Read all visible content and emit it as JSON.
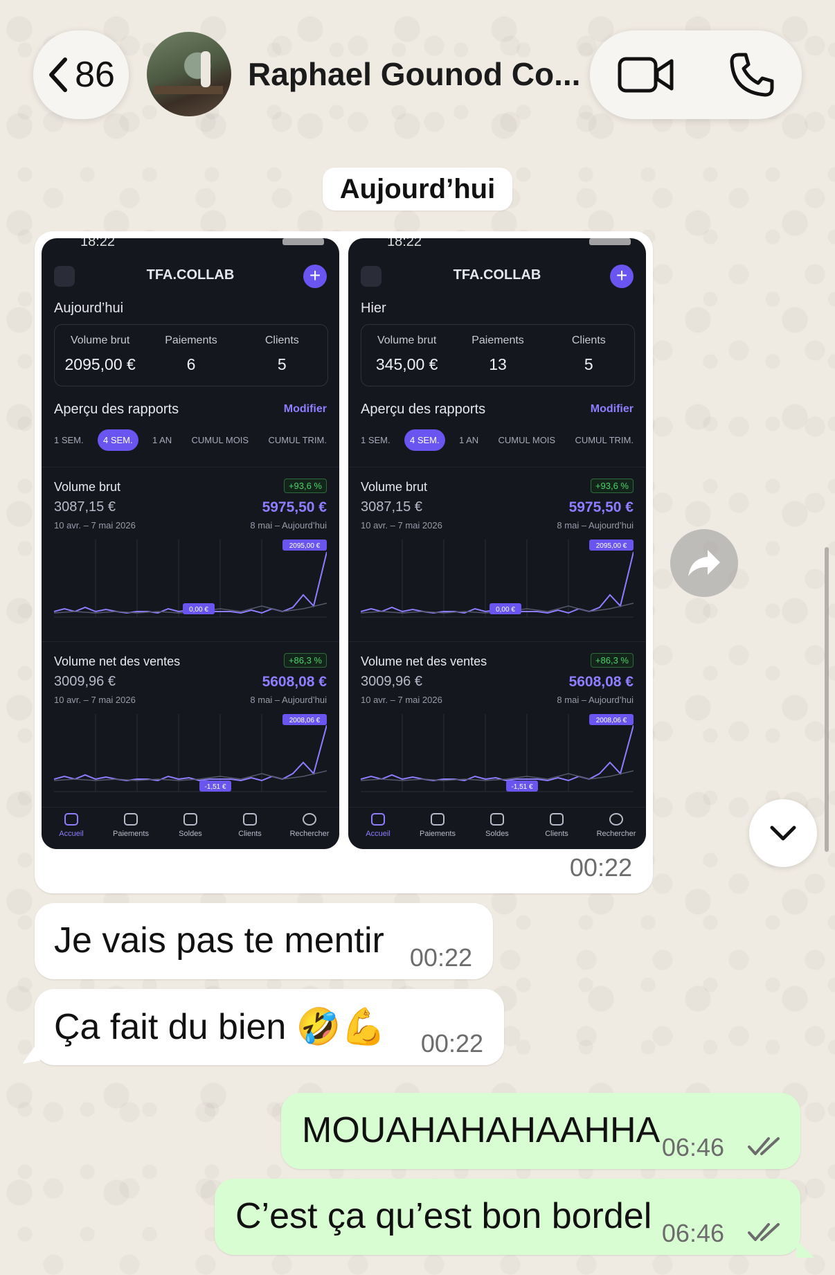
{
  "header": {
    "back_count": "86",
    "contact_name": "Raphael Gounod Co..."
  },
  "date_chip": "Aujourd’hui",
  "image_message": {
    "time": "00:22",
    "phones": [
      {
        "status_time": "18:22",
        "brand": "TFA.COLLAB",
        "day_label": "Aujourd’hui",
        "stats": [
          {
            "label": "Volume brut",
            "value": "2095,00 €"
          },
          {
            "label": "Paiements",
            "value": "6"
          },
          {
            "label": "Clients",
            "value": "5"
          }
        ],
        "report_title": "Aperçu des rapports",
        "modify_label": "Modifier",
        "tabs": [
          "1 SEM.",
          "4 SEM.",
          "1 AN",
          "CUMUL MOIS",
          "CUMUL TRIM."
        ],
        "cards": [
          {
            "title": "Volume brut",
            "pct": "+93,6 %",
            "prev": "3087,15 €",
            "curr": "5975,50 €",
            "prev_range": "10 avr. – 7 mai 2026",
            "curr_range": "8 mai – Aujourd’hui",
            "max_label": "2095,00 €",
            "min_label": "0,00 €"
          },
          {
            "title": "Volume net des ventes",
            "pct": "+86,3 %",
            "prev": "3009,96 €",
            "curr": "5608,08 €",
            "prev_range": "10 avr. – 7 mai 2026",
            "curr_range": "8 mai – Aujourd’hui",
            "max_label": "2008,06 €",
            "min_label": "-1,51 €"
          }
        ],
        "nav": [
          "Accueil",
          "Paiements",
          "Soldes",
          "Clients",
          "Rechercher"
        ]
      },
      {
        "status_time": "18:22",
        "brand": "TFA.COLLAB",
        "day_label": "Hier",
        "stats": [
          {
            "label": "Volume brut",
            "value": "345,00 €"
          },
          {
            "label": "Paiements",
            "value": "13"
          },
          {
            "label": "Clients",
            "value": "5"
          }
        ],
        "report_title": "Aperçu des rapports",
        "modify_label": "Modifier",
        "tabs": [
          "1 SEM.",
          "4 SEM.",
          "1 AN",
          "CUMUL MOIS",
          "CUMUL TRIM."
        ],
        "cards": [
          {
            "title": "Volume brut",
            "pct": "+93,6 %",
            "prev": "3087,15 €",
            "curr": "5975,50 €",
            "prev_range": "10 avr. – 7 mai 2026",
            "curr_range": "8 mai – Aujourd’hui",
            "max_label": "2095,00 €",
            "min_label": "0,00 €"
          },
          {
            "title": "Volume net des ventes",
            "pct": "+86,3 %",
            "prev": "3009,96 €",
            "curr": "5608,08 €",
            "prev_range": "10 avr. – 7 mai 2026",
            "curr_range": "8 mai – Aujourd’hui",
            "max_label": "2008,06 €",
            "min_label": "-1,51 €"
          }
        ],
        "nav": [
          "Accueil",
          "Paiements",
          "Soldes",
          "Clients",
          "Rechercher"
        ]
      }
    ]
  },
  "messages": [
    {
      "text": "Je vais pas te mentir",
      "time": "00:22"
    },
    {
      "text": "Ça fait du bien 🤣💪",
      "time": "00:22"
    },
    {
      "text": "MOUAHAHAHAAHHA",
      "time": "06:46"
    },
    {
      "text": "C’est ça qu’est bon bordel",
      "time": "06:46"
    }
  ],
  "colors": {
    "chat_bg": "#efeae2",
    "incoming": "#ffffff",
    "outgoing": "#d9fdd3",
    "accent": "#6a55f0",
    "read_ticks": "#6c6c6c"
  }
}
